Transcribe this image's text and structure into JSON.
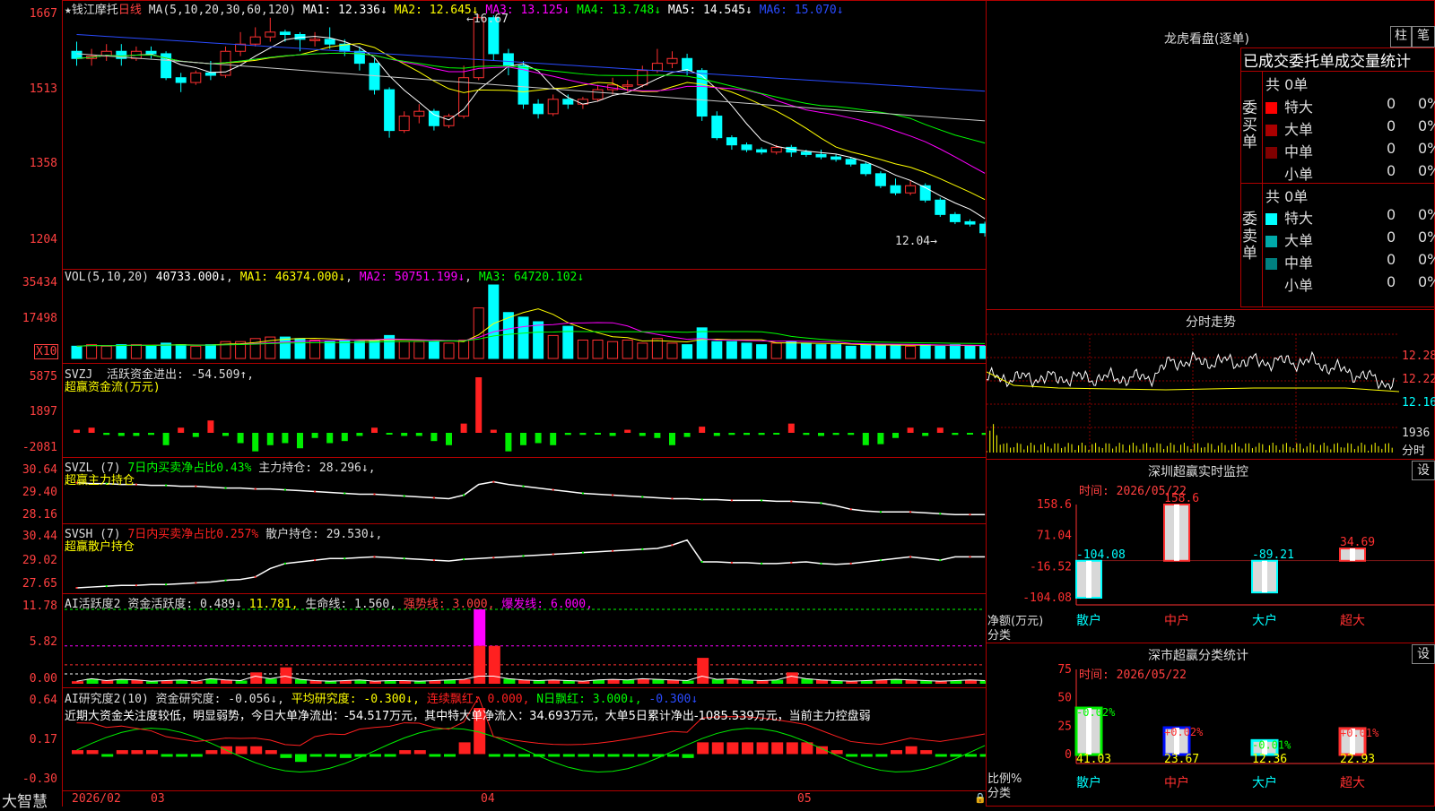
{
  "app": {
    "brand": "大智慧"
  },
  "main_chart": {
    "star": "★",
    "name": "钱江摩托",
    "period": "日线",
    "ma_header": "MA(5,10,20,30,60,120)",
    "ma": [
      {
        "label": "MA1: 12.336↓",
        "color": "#ffffff"
      },
      {
        "label": "MA2: 12.645↓",
        "color": "#ffff00"
      },
      {
        "label": "MA3: 13.125↓",
        "color": "#ff00ff"
      },
      {
        "label": "MA4: 13.748↓",
        "color": "#00ff00"
      },
      {
        "label": "MA5: 14.545↓",
        "color": "#ffffff"
      },
      {
        "label": "MA6: 15.070↓",
        "color": "#2a4bff"
      }
    ],
    "y_ticks": [
      "1667",
      "1513",
      "1358",
      "1204"
    ],
    "high_label": "←16.67",
    "low_label": "12.04→",
    "bars": [
      [
        15.9,
        15.75,
        16.1,
        15.6
      ],
      [
        15.75,
        15.8,
        15.95,
        15.6
      ],
      [
        15.8,
        15.9,
        16.05,
        15.7
      ],
      [
        15.9,
        15.75,
        16.05,
        15.6
      ],
      [
        15.75,
        15.9,
        16.0,
        15.7
      ],
      [
        15.9,
        15.85,
        16.0,
        15.75
      ],
      [
        15.85,
        15.35,
        15.9,
        15.3
      ],
      [
        15.35,
        15.25,
        15.45,
        15.05
      ],
      [
        15.25,
        15.45,
        15.5,
        15.2
      ],
      [
        15.45,
        15.4,
        15.7,
        15.3
      ],
      [
        15.4,
        15.9,
        16.0,
        15.35
      ],
      [
        15.9,
        16.05,
        16.3,
        15.8
      ],
      [
        16.05,
        16.2,
        16.4,
        16.0
      ],
      [
        16.2,
        16.3,
        16.6,
        16.1
      ],
      [
        16.3,
        16.25,
        16.35,
        16.1
      ],
      [
        16.25,
        16.15,
        16.3,
        15.9
      ],
      [
        16.15,
        16.15,
        16.3,
        16.0
      ],
      [
        16.15,
        16.05,
        16.4,
        15.95
      ],
      [
        16.05,
        15.9,
        16.15,
        15.8
      ],
      [
        15.9,
        15.65,
        16.0,
        15.5
      ],
      [
        15.65,
        15.1,
        15.75,
        15.0
      ],
      [
        15.1,
        14.25,
        15.15,
        14.1
      ],
      [
        14.25,
        14.55,
        14.65,
        14.2
      ],
      [
        14.55,
        14.65,
        14.8,
        14.4
      ],
      [
        14.65,
        14.35,
        14.7,
        14.25
      ],
      [
        14.35,
        14.55,
        14.6,
        14.3
      ],
      [
        14.55,
        15.35,
        15.6,
        14.5
      ],
      [
        15.35,
        16.6,
        16.67,
        15.3
      ],
      [
        16.6,
        15.85,
        16.65,
        15.7
      ],
      [
        15.85,
        15.6,
        15.95,
        15.4
      ],
      [
        15.6,
        14.8,
        15.7,
        14.7
      ],
      [
        14.8,
        14.6,
        14.9,
        14.5
      ],
      [
        14.6,
        14.9,
        15.0,
        14.55
      ],
      [
        14.9,
        14.8,
        15.0,
        14.7
      ],
      [
        14.8,
        14.9,
        14.95,
        14.7
      ],
      [
        14.9,
        15.1,
        15.2,
        14.85
      ],
      [
        15.1,
        15.2,
        15.35,
        15.0
      ],
      [
        15.2,
        15.2,
        15.3,
        15.05
      ],
      [
        15.2,
        15.5,
        15.6,
        15.15
      ],
      [
        15.5,
        15.65,
        15.95,
        15.45
      ],
      [
        15.65,
        15.75,
        15.9,
        15.55
      ],
      [
        15.75,
        15.5,
        15.85,
        15.4
      ],
      [
        15.5,
        14.55,
        15.55,
        14.45
      ],
      [
        14.55,
        14.1,
        14.65,
        14.05
      ],
      [
        14.1,
        13.95,
        14.15,
        13.85
      ],
      [
        13.95,
        13.85,
        14.0,
        13.8
      ],
      [
        13.85,
        13.8,
        13.9,
        13.75
      ],
      [
        13.8,
        13.9,
        13.95,
        13.75
      ],
      [
        13.9,
        13.8,
        13.95,
        13.7
      ],
      [
        13.8,
        13.75,
        13.85,
        13.7
      ],
      [
        13.75,
        13.7,
        13.85,
        13.65
      ],
      [
        13.7,
        13.65,
        13.75,
        13.6
      ],
      [
        13.65,
        13.55,
        13.7,
        13.5
      ],
      [
        13.55,
        13.35,
        13.6,
        13.3
      ],
      [
        13.35,
        13.1,
        13.4,
        13.05
      ],
      [
        13.1,
        12.95,
        13.25,
        12.9
      ],
      [
        12.95,
        13.1,
        13.2,
        12.9
      ],
      [
        13.1,
        12.8,
        13.15,
        12.75
      ],
      [
        12.8,
        12.5,
        12.85,
        12.45
      ],
      [
        12.5,
        12.35,
        12.55,
        12.3
      ],
      [
        12.35,
        12.3,
        12.4,
        12.25
      ],
      [
        12.3,
        12.12,
        12.35,
        12.04
      ]
    ]
  },
  "vol": {
    "header": "VOL(5,10,20)",
    "value": "40733.000↓",
    "ma": [
      {
        "label": "MA1: 46374.000↓",
        "color": "#ffff00"
      },
      {
        "label": "MA2: 50751.199↓",
        "color": "#ff00ff"
      },
      {
        "label": "MA3: 64720.102↓",
        "color": "#00ff00"
      }
    ],
    "y_ticks": [
      "35434",
      "17498"
    ],
    "unit": "X10",
    "values": [
      8,
      9,
      8,
      9,
      9,
      8,
      10,
      9,
      8,
      9,
      11,
      11,
      13,
      14,
      14,
      13,
      12,
      11,
      12,
      11,
      12,
      15,
      11,
      11,
      11,
      10,
      12,
      33,
      48,
      30,
      27,
      24,
      15,
      21,
      12,
      12,
      11,
      12,
      10,
      13,
      10,
      9,
      20,
      11,
      11,
      10,
      9,
      10,
      11,
      10,
      9,
      9,
      8,
      9,
      9,
      9,
      8,
      9,
      8,
      9,
      8,
      8
    ]
  },
  "svzj": {
    "name": "SVZJ",
    "text1": "活跃资金进出: -54.509↑,",
    "text2": "超赢资金流(万元)",
    "y_ticks": [
      "5875",
      "1897",
      "-2081"
    ],
    "values": [
      300,
      500,
      -200,
      -300,
      -300,
      -200,
      -1200,
      500,
      -400,
      1200,
      -300,
      -1000,
      -1800,
      -1200,
      -1000,
      -1500,
      -500,
      -1000,
      -800,
      -300,
      500,
      -100,
      -300,
      -300,
      -800,
      -1200,
      900,
      5400,
      300,
      -1800,
      -1200,
      -1000,
      -1200,
      -200,
      -200,
      -100,
      -300,
      300,
      -300,
      -500,
      -1200,
      -400,
      600,
      -300,
      -200,
      -200,
      -200,
      -100,
      900,
      -200,
      -300,
      -200,
      -200,
      -1200,
      -1100,
      -500,
      500,
      -300,
      500,
      -200,
      -100,
      -200
    ]
  },
  "svzl": {
    "name": "SVZL",
    "param": "(7)",
    "text1": "7日内买卖净占比0.43%",
    "text2": "主力持仓: 28.296↓,",
    "text3": "超赢主力持仓",
    "y_ticks": [
      "30.64",
      "29.40",
      "28.16"
    ],
    "values": [
      30.1,
      30.05,
      30.05,
      30.0,
      30.0,
      29.95,
      29.95,
      29.9,
      29.9,
      29.85,
      29.8,
      29.8,
      29.75,
      29.75,
      29.7,
      29.65,
      29.6,
      29.55,
      29.5,
      29.45,
      29.45,
      29.4,
      29.35,
      29.3,
      29.25,
      29.2,
      29.4,
      30.0,
      30.15,
      30.0,
      29.9,
      29.8,
      29.7,
      29.6,
      29.5,
      29.45,
      29.4,
      29.35,
      29.3,
      29.25,
      29.2,
      29.2,
      29.15,
      29.15,
      29.1,
      29.1,
      29.1,
      29.05,
      29.05,
      29.0,
      28.95,
      28.8,
      28.6,
      28.5,
      28.45,
      28.45,
      28.45,
      28.4,
      28.35,
      28.3,
      28.3,
      28.3
    ]
  },
  "svsh": {
    "name": "SVSH",
    "param": "(7)",
    "text1": "7日内买卖净占比0.257%",
    "text2": "散户持仓: 29.530↓,",
    "text3": "超赢散户持仓",
    "y_ticks": [
      "30.44",
      "29.02",
      "27.65"
    ],
    "values": [
      27.65,
      27.7,
      27.75,
      27.8,
      27.8,
      27.85,
      27.85,
      27.9,
      27.95,
      28.0,
      28.1,
      28.15,
      28.3,
      28.8,
      29.1,
      29.2,
      29.3,
      29.4,
      29.4,
      29.45,
      29.5,
      29.45,
      29.4,
      29.35,
      29.3,
      29.25,
      29.35,
      29.4,
      29.45,
      29.5,
      29.55,
      29.6,
      29.65,
      29.7,
      29.75,
      29.8,
      29.85,
      29.9,
      29.95,
      30.0,
      30.2,
      30.5,
      29.2,
      29.2,
      29.15,
      29.15,
      29.1,
      29.1,
      29.15,
      29.2,
      29.1,
      29.05,
      29.1,
      29.2,
      29.3,
      29.4,
      29.5,
      29.4,
      29.3,
      29.5,
      29.5,
      29.5
    ]
  },
  "ai_activity": {
    "name": "AI活跃度2",
    "t1": "资金活跃度: 0.489↓",
    "t2": "11.781,",
    "t3": "生命线: 1.560,",
    "t4": "强势线: 3.000,",
    "t5": "爆发线: 6.000,",
    "y_ticks": [
      "11.78",
      "5.82",
      "0.00"
    ],
    "values": [
      0.4,
      0.8,
      0.5,
      0.7,
      0.6,
      0.4,
      0.5,
      0.6,
      0.4,
      0.8,
      0.6,
      0.5,
      1.8,
      0.8,
      2.6,
      0.7,
      0.5,
      0.4,
      0.5,
      0.6,
      0.4,
      0.5,
      0.5,
      0.4,
      0.5,
      0.6,
      0.7,
      11.78,
      6.0,
      0.8,
      0.6,
      0.5,
      0.6,
      0.5,
      0.4,
      0.6,
      0.7,
      0.6,
      0.8,
      0.7,
      0.6,
      0.5,
      4.1,
      0.7,
      0.8,
      0.6,
      0.5,
      0.6,
      1.8,
      0.8,
      0.6,
      0.5,
      0.4,
      0.5,
      0.6,
      0.7,
      0.6,
      0.5,
      0.4,
      0.5,
      0.6,
      0.5
    ]
  },
  "ai_research": {
    "name": "AI研究度2(10)",
    "t1": "资金研究度: -0.056↓,",
    "t2": "平均研究度: -0.300↓,",
    "t3": "连续飘红: 0.000,",
    "t4": "N日飘红: 3.000↓,",
    "t5": "-0.300↓",
    "comment": "近期大资金关注度较低，明显弱势，今日大单净流出：-54.517万元，其中特大单净流入：34.693万元，大单5日累计净出-1085.539万元，当前主力控盘弱",
    "y_ticks": [
      "0.64",
      "0.17",
      "-0.30"
    ],
    "values": [
      0.1,
      0.1,
      0.05,
      0.1,
      0.1,
      0.1,
      0.05,
      0.05,
      0.05,
      0.1,
      0.15,
      0.15,
      0.15,
      0.1,
      0.0,
      -0.05,
      0.05,
      0.05,
      0.0,
      0.05,
      0.05,
      0.05,
      0.1,
      0.1,
      0.05,
      0.05,
      0.2,
      0.64,
      0.05,
      0.05,
      0.05,
      0.05,
      0.05,
      0.05,
      0.05,
      0.05,
      0.05,
      0.05,
      0.05,
      0.05,
      0.05,
      0.0,
      0.2,
      0.2,
      0.2,
      0.2,
      0.2,
      0.2,
      0.2,
      0.2,
      0.15,
      0.1,
      0.05,
      0.05,
      0.05,
      0.1,
      0.15,
      0.1,
      0.05,
      0.05,
      0.05,
      0.05
    ]
  },
  "x_axis": {
    "labels": [
      "2026/02",
      "03",
      "04",
      "05"
    ]
  },
  "right": {
    "lhb_title": "龙虎看盘(逐单)",
    "btn_bar": "柱",
    "btn_pen": "笔",
    "stat_title": "已成交委托单成交量统计",
    "buy_side_label": "委买单",
    "sell_side_label": "委卖单",
    "buy_total": "共 0单",
    "sell_total": "共 0单",
    "buy_rows": [
      {
        "name": "特大",
        "val": "0",
        "pct": "0%",
        "color": "#ff0000"
      },
      {
        "name": "大单",
        "val": "0",
        "pct": "0%",
        "color": "#aa0000"
      },
      {
        "name": "中单",
        "val": "0",
        "pct": "0%",
        "color": "#800000"
      },
      {
        "name": "小单",
        "val": "0",
        "pct": "0%",
        "color": ""
      }
    ],
    "sell_rows": [
      {
        "name": "特大",
        "val": "0",
        "pct": "0%",
        "color": "#00ffff"
      },
      {
        "name": "大单",
        "val": "0",
        "pct": "0%",
        "color": "#00aaaa"
      },
      {
        "name": "中单",
        "val": "0",
        "pct": "0%",
        "color": "#008080"
      },
      {
        "name": "小单",
        "val": "0",
        "pct": "0%",
        "color": ""
      }
    ],
    "intraday_title": "分时走势",
    "intraday_ticks": [
      "12.28",
      "12.22",
      "12.16",
      "1936",
      "分时"
    ],
    "sz_title": "深圳超赢实时监控",
    "set_label": "设",
    "sz_time": "时间: 2026/05/22",
    "sz_ticks": [
      "158.6",
      "71.04",
      "-16.52",
      "-104.08"
    ],
    "sz_ylabel1": "净额(万元)",
    "sz_ylabel2": "分类",
    "sz_cats": [
      "散户",
      "中户",
      "大户",
      "超大"
    ],
    "sz_vals": [
      -104.08,
      158.6,
      -89.21,
      34.69
    ],
    "sz_val_labels": [
      "-104.08",
      "158.6",
      "-89.21",
      "34.69"
    ],
    "cls_title": "深市超赢分类统计",
    "cls_time": "时间: 2026/05/22",
    "cls_ticks": [
      "75",
      "50",
      "25",
      "0"
    ],
    "cls_ylabel1": "比例%",
    "cls_ylabel2": "分类",
    "cls_vals": [
      41.03,
      23.67,
      12.36,
      22.93
    ],
    "cls_pcts": [
      "-0.02%",
      "+0.02%",
      "-0.01%",
      "+0.01%"
    ]
  }
}
